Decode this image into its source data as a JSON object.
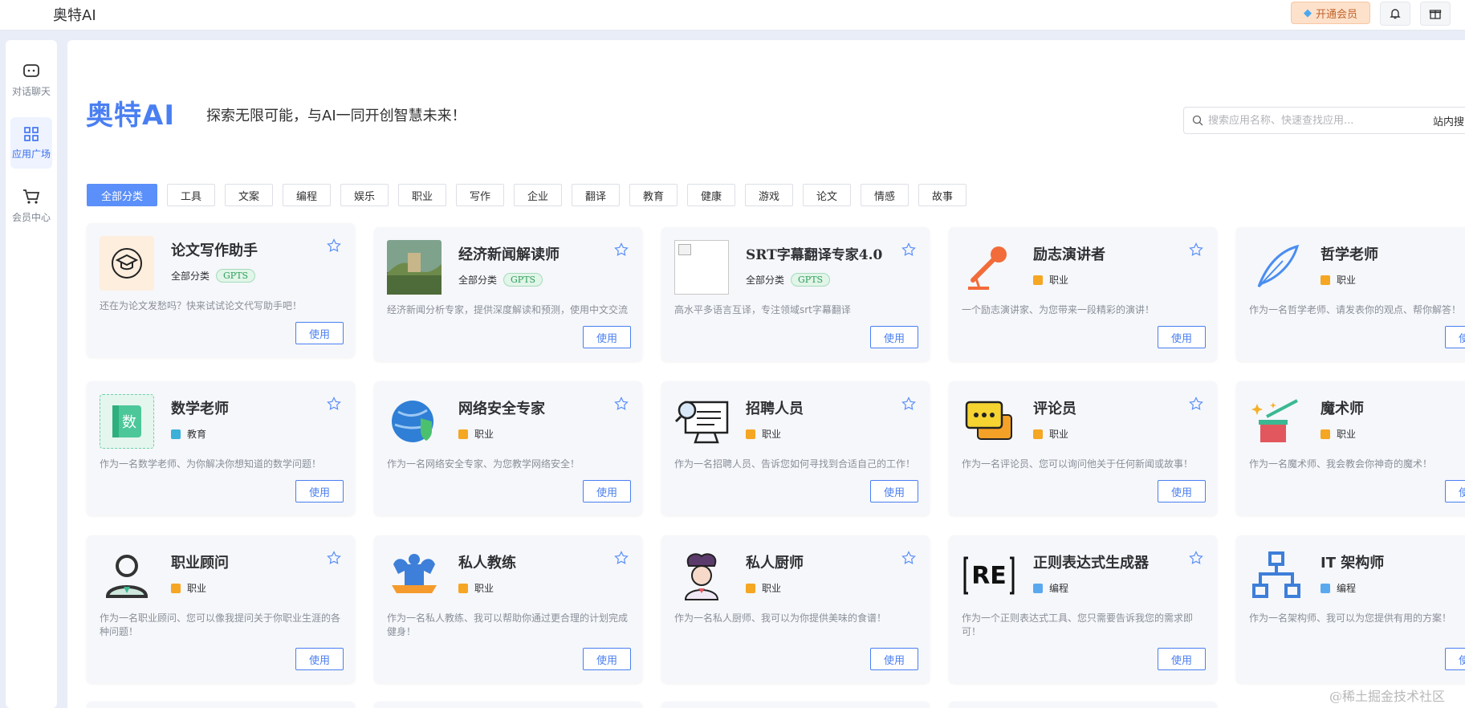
{
  "app": {
    "brand": "奥特AI",
    "vip_label": "开通会员"
  },
  "sidebar": {
    "items": [
      {
        "label": "对话聊天"
      },
      {
        "label": "应用广场"
      },
      {
        "label": "会员中心"
      }
    ]
  },
  "hero": {
    "title": "奥特AI",
    "subtitle": "探索无限可能，与AI一同开创智慧未来！"
  },
  "search": {
    "placeholder": "搜索应用名称、快速查找应用...",
    "scope": "站内搜"
  },
  "categories": [
    "全部分类",
    "工具",
    "文案",
    "编程",
    "娱乐",
    "职业",
    "写作",
    "企业",
    "翻译",
    "教育",
    "健康",
    "游戏",
    "论文",
    "情感",
    "故事"
  ],
  "use_label": "使用",
  "gpts_label": "GPTS",
  "cards": [
    {
      "title": "论文写作助手",
      "category": "全部分类",
      "gpts": true,
      "desc": "还在为论文发愁吗？快来试试论文代写助手吧！"
    },
    {
      "title": "经济新闻解读师",
      "category": "全部分类",
      "gpts": true,
      "desc": "经济新闻分析专家，提供深度解读和预测，使用中文交流"
    },
    {
      "title": "SRT字幕翻译专家4.0",
      "category": "全部分类",
      "gpts": true,
      "desc": "高水平多语言互译，专注领域srt字幕翻译"
    },
    {
      "title": "励志演讲者",
      "category": "职业",
      "gpts": false,
      "desc": "一个励志演讲家、为您带来一段精彩的演讲！"
    },
    {
      "title": "哲学老师",
      "category": "职业",
      "gpts": false,
      "desc": "作为一名哲学老师、请发表你的观点、帮你解答！"
    },
    {
      "title": "数学老师",
      "category": "教育",
      "gpts": false,
      "desc": "作为一名数学老师、为你解决你想知道的数学问题！"
    },
    {
      "title": "网络安全专家",
      "category": "职业",
      "gpts": false,
      "desc": "作为一名网络安全专家、为您教学网络安全！"
    },
    {
      "title": "招聘人员",
      "category": "职业",
      "gpts": false,
      "desc": "作为一名招聘人员、告诉您如何寻找到合适自己的工作！"
    },
    {
      "title": "评论员",
      "category": "职业",
      "gpts": false,
      "desc": "作为一名评论员、您可以询问他关于任何新闻或故事！"
    },
    {
      "title": "魔术师",
      "category": "职业",
      "gpts": false,
      "desc": "作为一名魔术师、我会教会你神奇的魔术！"
    },
    {
      "title": "职业顾问",
      "category": "职业",
      "gpts": false,
      "desc": "作为一名职业顾问、您可以像我提问关于你职业生涯的各种问题！"
    },
    {
      "title": "私人教练",
      "category": "职业",
      "gpts": false,
      "desc": "作为一名私人教练、我可以帮助你通过更合理的计划完成健身！"
    },
    {
      "title": "私人厨师",
      "category": "职业",
      "gpts": false,
      "desc": "作为一名私人厨师、我可以为你提供美味的食谱！"
    },
    {
      "title": "正则表达式生成器",
      "category": "编程",
      "gpts": false,
      "desc": "作为一个正则表达式工具、您只需要告诉我您的需求即可！"
    },
    {
      "title": "IT 架构师",
      "category": "编程",
      "gpts": false,
      "desc": "作为一名架构师、我可以为您提供有用的方案！"
    }
  ],
  "watermark": "@稀土掘金技术社区"
}
